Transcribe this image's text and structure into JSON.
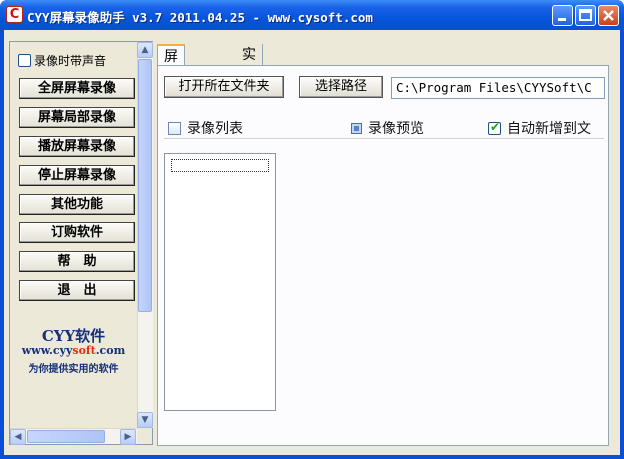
{
  "window": {
    "title": "CYY屏幕录像助手 v3.7 2011.04.25 - www.cysoft.com",
    "icon": "cyy-app-icon"
  },
  "sidebar": {
    "record_sound_label": "录像时带声音",
    "record_sound_checked": false,
    "buttons": [
      "全屏屏幕录像",
      "屏幕局部录像",
      "播放屏幕录像",
      "停止屏幕录像",
      "其他功能",
      "订购软件",
      "帮　助",
      "退　出"
    ],
    "brand_name": "CYY软件",
    "brand_url_prefix": "www.cyy",
    "brand_url_red": "soft",
    "brand_url_suffix": ".com",
    "brand_slogan": "为你提供实用的软件"
  },
  "tabs": [
    {
      "label": "屏幕录像",
      "active": true
    },
    {
      "label": "实例演示",
      "active": false
    }
  ],
  "main": {
    "open_folder_label": "打开所在文件夹",
    "choose_path_label": "选择路径",
    "path_value": "C:\\Program Files\\CYYSoft\\C",
    "list_label": "录像列表",
    "preview_label": "录像预览",
    "preview_checked": false,
    "auto_add_label": "自动新增到文",
    "auto_add_checked": true
  }
}
